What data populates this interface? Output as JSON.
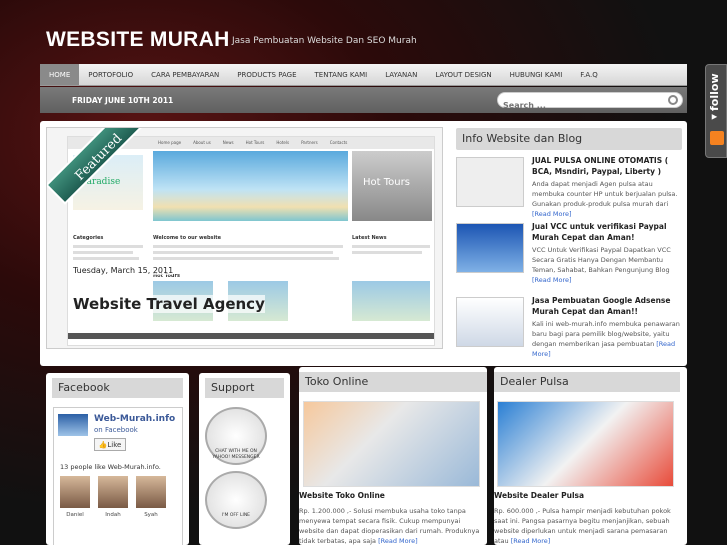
{
  "header": {
    "title": "WEBSITE MURAH",
    "tagline": "Jasa Pembuatan Website Dan SEO Murah"
  },
  "nav": {
    "items": [
      "HOME",
      "PORTOFOLIO",
      "CARA PEMBAYARAN",
      "PRODUCTS PAGE",
      "TENTANG KAMI",
      "LAYANAN",
      "LAYOUT DESIGN",
      "HUBUNGI KAMI",
      "F.A.Q"
    ],
    "active_index": 0
  },
  "subbar": {
    "date": "FRIDAY JUNE 10TH 2011",
    "search_placeholder": "Search ..."
  },
  "follow": {
    "label": "follow"
  },
  "featured": {
    "ribbon": "Featured",
    "date": "Tuesday, March 15, 2011",
    "title": "Website Travel Agency",
    "screenshot": {
      "nav": [
        "Home page",
        "About us",
        "News",
        "Hot Tours",
        "Hotels",
        "Partners",
        "Contacts"
      ],
      "logo": "Paradise",
      "hot": "Hot Tours",
      "categories": "Categories",
      "welcome": "Welcome to our website",
      "latest": "Latest News",
      "hot2": "Hot Tours"
    }
  },
  "info": {
    "heading": "Info Website dan Blog",
    "read_more": "[Read More]",
    "posts": [
      {
        "title": "JUAL PULSA ONLINE OTOMATIS ( BCA, Msndiri, Paypal, Liberty )",
        "body": "Anda dapat menjadi Agen pulsa atau membuka counter HP untuk berjualan pulsa. Gunakan produk-produk pulsa murah dari"
      },
      {
        "title": "Jual VCC untuk verifikasi Paypal Murah Cepat dan Aman!",
        "body": "VCC Untuk Verifikasi Paypal Dapatkan VCC Secara Gratis Hanya Dengan Membantu Teman, Sahabat, Bahkan Pengunjung Blog"
      },
      {
        "title": "Jasa Pembuatan Google Adsense Murah Cepat dan Aman!!",
        "body": "Kali ini web-murah.info membuka penawaran baru bagi para pemilik blog/website, yaitu dengan memberikan jasa pembuatan"
      }
    ]
  },
  "facebook": {
    "heading": "Facebook",
    "page_name": "Web-Murah.info",
    "on": "on Facebook",
    "like": "Like",
    "count_text": "13 people like Web-Murah.info.",
    "fans": [
      "Daniel",
      "Indah",
      "Syah"
    ]
  },
  "support": {
    "heading": "Support",
    "badge1": "CHAT WITH ME ON YAHOO! MESSENGER",
    "badge2": "I'M OFF LINE"
  },
  "toko": {
    "heading": "Toko Online",
    "title": "Website Toko Online",
    "body": "Rp. 1.200.000 ,- Solusi membuka usaha toko tanpa menyewa tempat secara fisik. Cukup mempunyai website dan dapat dioperasikan dari rumah. Produknya tidak terbatas, apa saja",
    "read_more": "[Read More]"
  },
  "dealer": {
    "heading": "Dealer Pulsa",
    "title": "Website Dealer Pulsa",
    "body": "Rp. 600.000 ,- Pulsa hampir menjadi kebutuhan pokok saat ini. Pangsa pasarnya begitu menjanjikan, sebuah website diperlukan untuk menjadi sarana pemasaran atau",
    "read_more": "[Read More]"
  }
}
